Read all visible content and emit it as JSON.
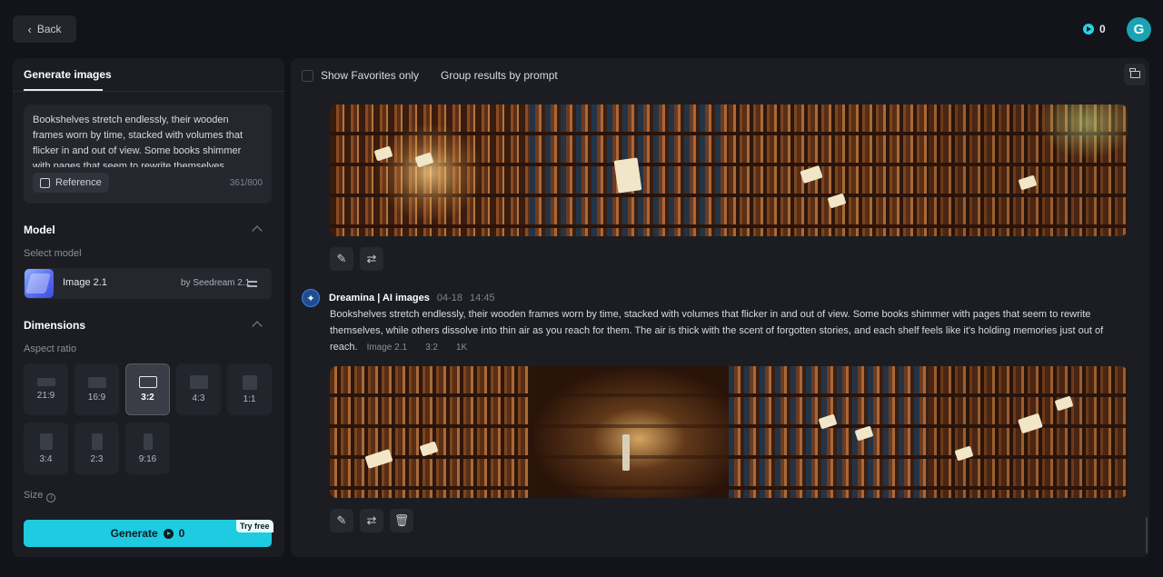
{
  "header": {
    "back_label": "Back",
    "credits": "0",
    "avatar_initial": "G"
  },
  "sidebar": {
    "tab_title": "Generate images",
    "prompt_text": "Bookshelves stretch endlessly, their wooden frames worn by time, stacked with volumes that flicker in and out of view. Some books shimmer with pages that seem to rewrite themselves...",
    "reference_label": "Reference",
    "char_counter": "361/800",
    "model_section": "Model",
    "select_model_label": "Select model",
    "model_name": "Image 2.1",
    "model_by": "by Seedream 2.1",
    "dimensions_section": "Dimensions",
    "aspect_ratio_label": "Aspect ratio",
    "aspect_ratios": [
      "21:9",
      "16:9",
      "3:2",
      "4:3",
      "1:1",
      "3:4",
      "2:3",
      "9:16"
    ],
    "selected_ratio": "3:2",
    "size_label": "Size",
    "generate_label": "Generate",
    "generate_cost": "0",
    "try_free_badge": "Try free"
  },
  "main": {
    "show_favorites_label": "Show Favorites only",
    "group_by_prompt_label": "Group results by prompt",
    "generation": {
      "author": "Dreamina | AI images",
      "date": "04-18",
      "time": "14:45",
      "prompt": "Bookshelves stretch endlessly, their wooden frames worn by time, stacked with volumes that flicker in and out of view. Some books shimmer with pages that seem to rewrite themselves, while others dissolve into thin air as you reach for them. The air is thick with the scent of forgotten stories, and each shelf feels like it's holding memories just out of reach.",
      "tag_model": "Image 2.1",
      "tag_ratio": "3:2",
      "tag_resolution": "1K"
    }
  },
  "colors": {
    "accent": "#1ecbe1",
    "panel": "#1b1d23",
    "background": "#121419"
  }
}
